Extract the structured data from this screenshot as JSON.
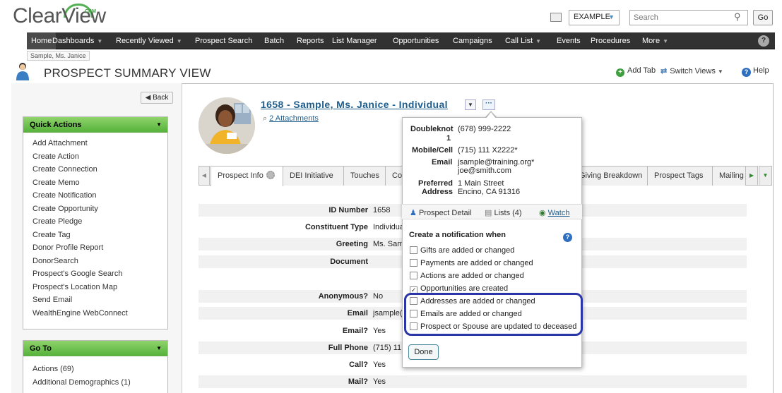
{
  "app": {
    "logo_text": "ClearView",
    "logo_crm": "CRM",
    "database": "EXAMPLE",
    "search_placeholder": "Search",
    "go_label": "Go"
  },
  "nav": {
    "items": [
      {
        "label": "Home",
        "caret": false
      },
      {
        "label": "Dashboards",
        "caret": true
      },
      {
        "label": "Recently Viewed",
        "caret": true
      },
      {
        "label": "Prospect Search",
        "caret": false
      },
      {
        "label": "Batch",
        "caret": false
      },
      {
        "label": "Reports",
        "caret": false
      },
      {
        "label": "List Manager",
        "caret": false
      },
      {
        "label": "Opportunities",
        "caret": false
      },
      {
        "label": "Campaigns",
        "caret": false
      },
      {
        "label": "Call List",
        "caret": true
      },
      {
        "label": "Events",
        "caret": false
      },
      {
        "label": "Procedures",
        "caret": false
      },
      {
        "label": "More",
        "caret": true
      }
    ]
  },
  "breadcrumb": "Sample, Ms. Janice",
  "header": {
    "title": "PROSPECT SUMMARY VIEW",
    "add_tab": "Add Tab",
    "switch_views": "Switch Views",
    "help": "Help"
  },
  "back_label": "Back",
  "quick_actions": {
    "title": "Quick Actions",
    "items": [
      "Add Attachment",
      "Create Action",
      "Create Connection",
      "Create Memo",
      "Create Notification",
      "Create Opportunity",
      "Create Pledge",
      "Create Tag",
      "Donor Profile Report",
      "DonorSearch",
      "Prospect's Google Search",
      "Prospect's Location Map",
      "Send Email",
      "WealthEngine WebConnect"
    ]
  },
  "go_to": {
    "title": "Go To",
    "items": [
      "Actions (69)",
      "Additional Demographics (1)"
    ]
  },
  "prospect": {
    "title": "1658 - Sample, Ms. Janice - Individual",
    "attachments": "2 Attachments"
  },
  "tabs": {
    "items": [
      "Prospect Info",
      "DEI Initiative",
      "Touches",
      "Co",
      "Giving Breakdown",
      "Prospect Tags",
      "Mailing"
    ]
  },
  "details": [
    {
      "label": "ID Number",
      "value": "1658"
    },
    {
      "label": "Constituent Type",
      "value": "Individua"
    },
    {
      "label": "Greeting",
      "value": "Ms. Sam"
    },
    {
      "label": "Document",
      "value": ""
    },
    {
      "label": "Anonymous?",
      "value": "No"
    },
    {
      "label": "Email",
      "value": "jsample("
    },
    {
      "label": "Email?",
      "value": "Yes"
    },
    {
      "label": "Full Phone",
      "value": "(715) 11"
    },
    {
      "label": "Call?",
      "value": "Yes"
    },
    {
      "label": "Mail?",
      "value": "Yes"
    }
  ],
  "popup": {
    "doubleknot_label": "Doubleknot",
    "doubleknot_suffix": "1",
    "doubleknot_value": "(678) 999-2222",
    "mobile_label": "Mobile/Cell",
    "mobile_value": "(715) 111 X2222*",
    "email_label": "Email",
    "email_value_1": "jsample@training.org*",
    "email_value_2": "joe@smith.com",
    "preferred_label": "Preferred",
    "address_label": "Address",
    "address_line_1": "1 Main Street",
    "address_line_2": "Encino, CA 91316",
    "link_detail": "Prospect Detail",
    "link_lists": "Lists (4)",
    "link_watch": "Watch",
    "notif_title": "Create a notification when",
    "options": [
      {
        "label": "Gifts are added or changed",
        "checked": false
      },
      {
        "label": "Payments are added or changed",
        "checked": false
      },
      {
        "label": "Actions are added or changed",
        "checked": false
      },
      {
        "label": "Opportunities are created",
        "checked": true
      },
      {
        "label": "Addresses are added or changed",
        "checked": false
      },
      {
        "label": "Emails are added or changed",
        "checked": false
      },
      {
        "label": "Prospect or Spouse are updated to deceased",
        "checked": false
      }
    ],
    "done_label": "Done"
  }
}
